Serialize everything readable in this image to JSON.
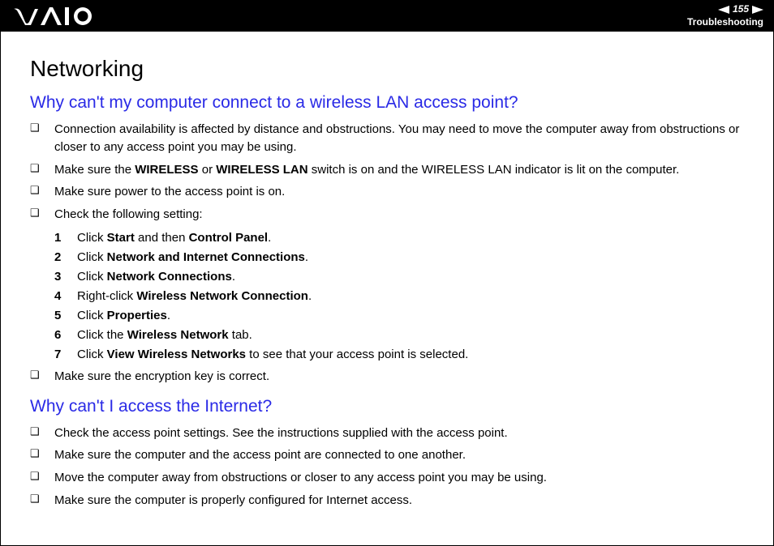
{
  "header": {
    "page_number": "155",
    "section": "Troubleshooting"
  },
  "content": {
    "title": "Networking",
    "q1": {
      "heading": "Why can't my computer connect to a wireless LAN access point?",
      "b1": "Connection availability is affected by distance and obstructions. You may need to move the computer away from obstructions or closer to any access point you may be using.",
      "b2_pre": "Make sure the ",
      "b2_s1": "WIRELESS",
      "b2_mid": " or ",
      "b2_s2": "WIRELESS LAN",
      "b2_post": " switch is on and the WIRELESS LAN indicator is lit on the computer.",
      "b3": "Make sure power to the access point is on.",
      "b4": "Check the following setting:",
      "steps": {
        "s1_a": "Click ",
        "s1_b1": "Start",
        "s1_mid": " and then ",
        "s1_b2": "Control Panel",
        "s1_end": ".",
        "s2_a": "Click ",
        "s2_b": "Network and Internet Connections",
        "s2_end": ".",
        "s3_a": "Click ",
        "s3_b": "Network Connections",
        "s3_end": ".",
        "s4_a": "Right-click ",
        "s4_b": "Wireless Network Connection",
        "s4_end": ".",
        "s5_a": "Click ",
        "s5_b": "Properties",
        "s5_end": ".",
        "s6_a": "Click the ",
        "s6_b": "Wireless Network",
        "s6_end": " tab.",
        "s7_a": "Click ",
        "s7_b": "View Wireless Networks",
        "s7_end": " to see that your access point is selected."
      },
      "b5": "Make sure the encryption key is correct."
    },
    "q2": {
      "heading": "Why can't I access the Internet?",
      "b1": "Check the access point settings. See the instructions supplied with the access point.",
      "b2": "Make sure the computer and the access point are connected to one another.",
      "b3": "Move the computer away from obstructions or closer to any access point you may be using.",
      "b4": "Make sure the computer is properly configured for Internet access."
    }
  }
}
